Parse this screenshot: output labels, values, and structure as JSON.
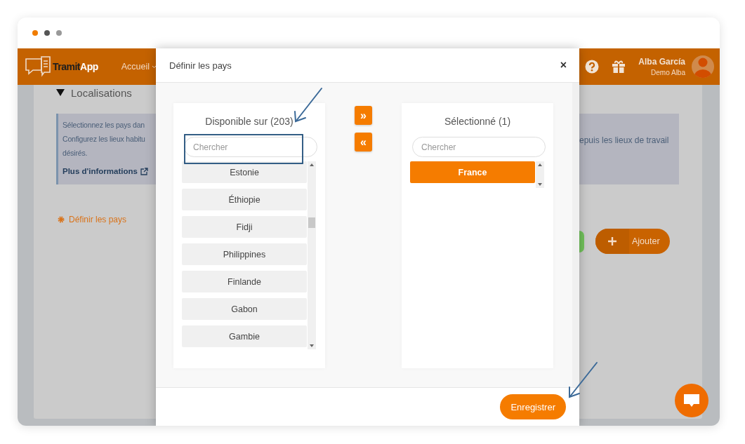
{
  "window": {
    "controls": [
      {
        "color": "#f07c00"
      },
      {
        "color": "#555555"
      },
      {
        "color": "#999999"
      }
    ]
  },
  "header": {
    "brand": "Tramit",
    "brand_suffix": "App",
    "nav": [
      {
        "label": "Accueil"
      }
    ],
    "user": {
      "name": "Alba García",
      "account": "Demo Alba"
    }
  },
  "page": {
    "section_title": "Localisations",
    "info": {
      "left_lines": [
        "Sélectionnez les pays dan",
        "Configurez les lieux habitu",
        "désirés."
      ],
      "right_line": "epuis les lieux de travail",
      "link": "Plus d'informations"
    },
    "define_link": "Définir les pays",
    "add_button": "Ajouter"
  },
  "modal": {
    "title": "Définir les pays",
    "close": "×",
    "move_buttons": [
      "»",
      "«"
    ],
    "save": "Enregistrer",
    "panels": [
      {
        "title": "Disponible sur (203)",
        "placeholder": "Chercher",
        "items": [
          {
            "label": "Estonie",
            "selected": false
          },
          {
            "label": "Éthiopie",
            "selected": false
          },
          {
            "label": "Fidji",
            "selected": false
          },
          {
            "label": "Philippines",
            "selected": false
          },
          {
            "label": "Finlande",
            "selected": false
          },
          {
            "label": "Gabon",
            "selected": false
          },
          {
            "label": "Gambie",
            "selected": false
          }
        ]
      },
      {
        "title": "Sélectionné (1)",
        "placeholder": "Chercher",
        "items": [
          {
            "label": "France",
            "selected": true
          }
        ]
      }
    ]
  }
}
